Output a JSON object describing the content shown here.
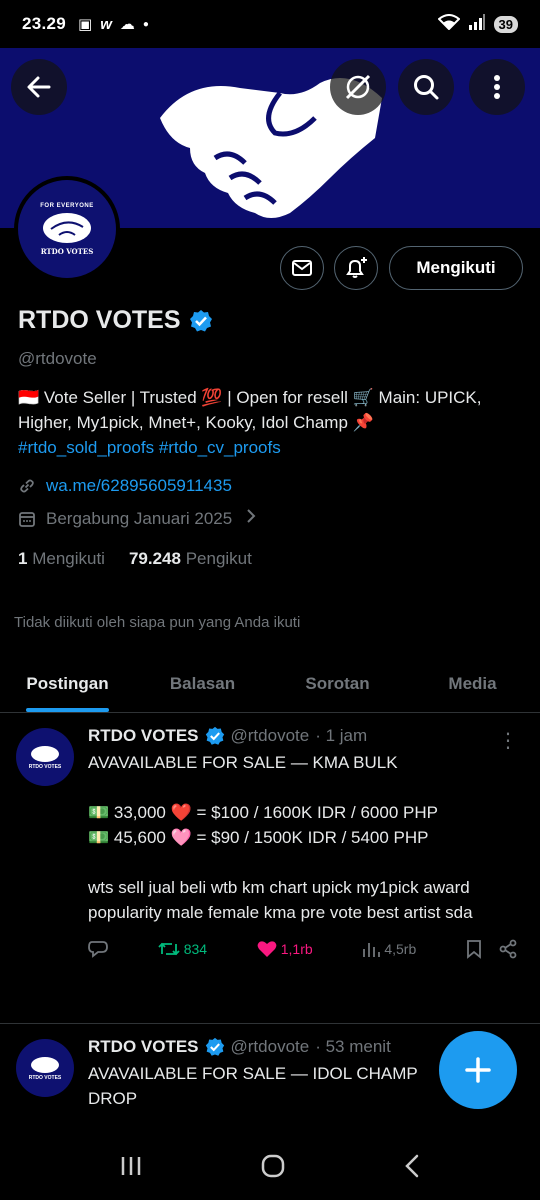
{
  "status_bar": {
    "time": "23.29",
    "app_icons": [
      "scan-icon",
      "w-icon",
      "cloud-icon",
      "dot-icon"
    ],
    "battery": "39"
  },
  "header_buttons": [
    "back-icon",
    "grok-icon",
    "search-icon",
    "more-icon"
  ],
  "avatar": {
    "top_text": "FOR EVERYONE",
    "name_text": "RTDO VOTES"
  },
  "profile_actions": {
    "follow_label": "Mengikuti"
  },
  "profile": {
    "name": "RTDO VOTES",
    "handle": "@rtdovote",
    "bio_text": "🇮🇩 Vote Seller | Trusted 💯 | Open for resell 🛒 Main: UPICK, Higher, My1pick, Mnet+, Kooky, Idol Champ 📌",
    "bio_tags": "#rtdo_sold_proofs #rtdo_cv_proofs",
    "link": "wa.me/62895605911435",
    "joined": "Bergabung Januari 2025",
    "following_count": "1",
    "following_label": "Mengikuti",
    "followers_count": "79.248",
    "followers_label": "Pengikut",
    "followed_note": "Tidak diikuti oleh siapa pun yang Anda ikuti"
  },
  "tabs": [
    {
      "label": "Postingan",
      "active": true
    },
    {
      "label": "Balasan",
      "active": false
    },
    {
      "label": "Sorotan",
      "active": false
    },
    {
      "label": "Media",
      "active": false
    }
  ],
  "posts": [
    {
      "name": "RTDO VOTES",
      "handle": "@rtdovote",
      "time": "· 1 jam",
      "lines": [
        "AVAVAILABLE FOR SALE — KMA BULK",
        "",
        "💵 33,000 ❤️ = $100 / 1600K IDR / 6000 PHP",
        "💵 45,600 🩷 = $90 / 1500K IDR / 5400 PHP",
        "",
        "wts sell jual beli wtb km chart upick my1pick award",
        "popularity male female kma pre vote best artist sda"
      ],
      "retweets": "834",
      "likes": "1,1rb",
      "views": "4,5rb"
    },
    {
      "name": "RTDO VOTES",
      "handle": "@rtdovote",
      "time": "· 53 menit",
      "lines": [
        "AVAVAILABLE FOR SALE — IDOL CHAMP",
        "DROP"
      ]
    }
  ],
  "colors": {
    "accent": "#1d9bf0",
    "like": "#f91880",
    "retweet": "#00ba7c",
    "banner": "#0c0d6e"
  }
}
